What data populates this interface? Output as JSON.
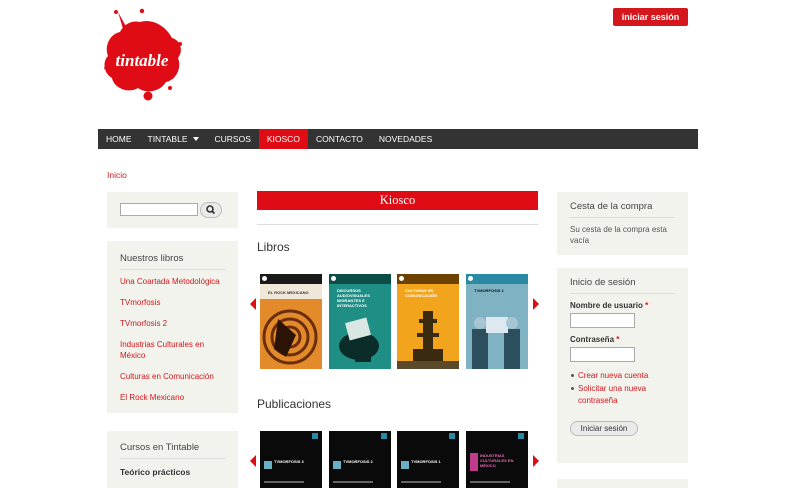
{
  "header": {
    "logo_text": "tintable",
    "login_button": "iniciar sesión"
  },
  "nav": {
    "items": [
      {
        "label": "HOME"
      },
      {
        "label": "TINTABLE"
      },
      {
        "label": "CURSOS"
      },
      {
        "label": "KIOSCO"
      },
      {
        "label": "CONTACTO"
      },
      {
        "label": "NOVEDADES"
      }
    ]
  },
  "breadcrumb": "Inicio",
  "sidebar_left": {
    "books_title": "Nuestros libros",
    "books": [
      "Una Coartada Metodológica",
      "TVmorfosis",
      "TVmorfosis 2",
      "Industrias Culturales en México",
      "Culturas en Comunicación",
      "El Rock Mexicano"
    ],
    "courses_title": "Cursos en Tintable",
    "courses_sub": "Teórico prácticos"
  },
  "main": {
    "title": "Kiosco",
    "books_section": "Libros",
    "book_covers": [
      {
        "title": "EL ROCK MEXICANO",
        "color": "#e38a2a"
      },
      {
        "title": "DISCURSOS AUDIOVISUALES MIGRANTES E INTERACTIVOS",
        "color": "#1f8f86"
      },
      {
        "title": "CULTURAS EN COMUNICACIÓN",
        "color": "#f2a51c"
      },
      {
        "title": "TVMORFOSIS 2",
        "color": "#2a8aa3"
      }
    ],
    "publications_section": "Publicaciones",
    "publication_covers": [
      {
        "title": "TVMORFOSIS 3",
        "color": "#0a0a0a"
      },
      {
        "title": "TVMORFOSIS 2",
        "color": "#0a0a0a"
      },
      {
        "title": "TVMORFOSIS 1",
        "color": "#0a0a0a"
      },
      {
        "title": "INDUSTRIAS CULTURALES EN MÉXICO",
        "color": "#0a0a0a"
      }
    ]
  },
  "sidebar_right": {
    "cart_title": "Cesta de la compra",
    "cart_empty": "Su cesta de la compra esta vacía",
    "login_title": "Inicio de sesión",
    "username_label": "Nombre de usuario",
    "password_label": "Contraseña",
    "required_mark": "*",
    "create_account": "Crear nueva cuenta",
    "request_password": "Solicitar una nueva contraseña",
    "submit": "Iniciar sesión"
  },
  "colors": {
    "accent": "#e00c15",
    "nav_bg": "#333333",
    "block_bg": "#f3f3ee"
  }
}
